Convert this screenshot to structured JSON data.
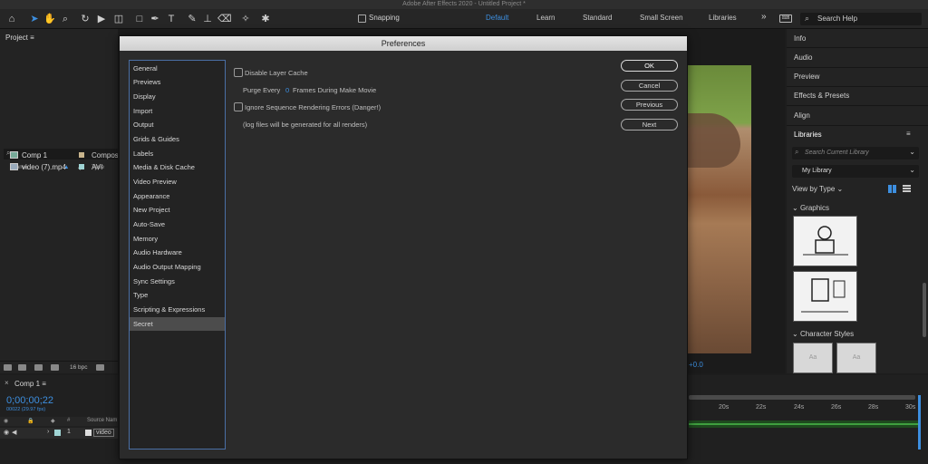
{
  "window": {
    "title": "Adobe After Effects 2020 - Untitled Project *"
  },
  "toolbar": {
    "snapping_label": "Snapping",
    "workspaces": [
      "Default",
      "Learn",
      "Standard",
      "Small Screen",
      "Libraries"
    ],
    "active_workspace": "Default",
    "search_help": "Search Help",
    "more": "»"
  },
  "project": {
    "title": "Project",
    "menu": "≡",
    "search_icon": "⌕",
    "columns": {
      "name": "Name",
      "type": "Type"
    },
    "items": [
      {
        "name": "Comp 1",
        "type": "Compos",
        "color": "#c8b48c"
      },
      {
        "name": "video (7).mp4",
        "type": "AVI",
        "color": "#9fd4d4"
      }
    ],
    "bpc": "16 bpc"
  },
  "viewer": {
    "zoom_readout": "+0.0"
  },
  "timeline": {
    "tab": "Comp 1",
    "close": "×",
    "timecode": "0;00;00;22",
    "fps_info": "00022 (29.97 fps)",
    "col_source": "Source Nam",
    "col_hash": "#",
    "layer_num": "1",
    "layer_label": "video",
    "ticks": [
      "20s",
      "22s",
      "24s",
      "26s",
      "28s",
      "30s"
    ]
  },
  "right_panel": {
    "items": [
      "Info",
      "Audio",
      "Preview",
      "Effects & Presets",
      "Align"
    ],
    "libraries": "Libraries",
    "lib_search_placeholder": "Search Current Library",
    "library": "My Library",
    "view_by": "View by Type",
    "graphics": "Graphics",
    "character_styles": "Character Styles",
    "aa": "Aa"
  },
  "dialog": {
    "title": "Preferences",
    "categories": [
      "General",
      "Previews",
      "Display",
      "Import",
      "Output",
      "Grids & Guides",
      "Labels",
      "Media & Disk Cache",
      "Video Preview",
      "Appearance",
      "New Project",
      "Auto-Save",
      "Memory",
      "Audio Hardware",
      "Audio Output Mapping",
      "Sync Settings",
      "Type",
      "Scripting & Expressions",
      "Secret"
    ],
    "selected": "Secret",
    "disable_layer_cache": "Disable Layer Cache",
    "purge_every": "Purge Every",
    "purge_value": "0",
    "frames_during": "Frames During Make Movie",
    "ignore_errors": "Ignore Sequence Rendering Errors (Danger!)",
    "log_note": "(log files will be generated for all renders)",
    "buttons": {
      "ok": "OK",
      "cancel": "Cancel",
      "previous": "Previous",
      "next": "Next"
    }
  }
}
